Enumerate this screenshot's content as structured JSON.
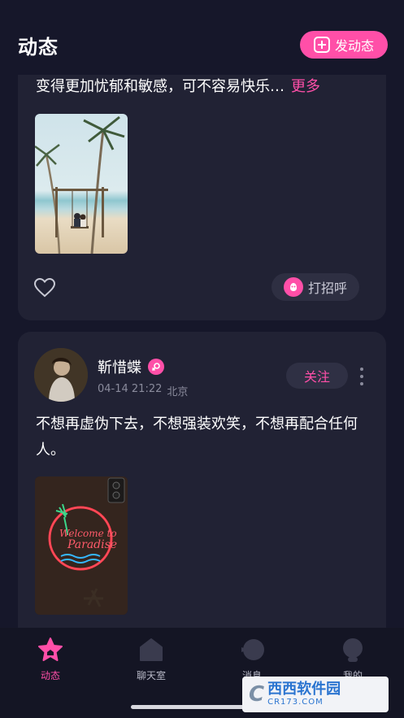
{
  "header": {
    "title": "动态",
    "post_button_label": "发动态"
  },
  "feed": {
    "posts": [
      {
        "text": "变得更加忧郁和敏感，可不容易快乐…",
        "more_label": "更多",
        "greet_label": "打招呼"
      },
      {
        "username": "靳惜蝶",
        "date": "04-14 21:22",
        "location": "北京",
        "follow_label": "关注",
        "text": "不想再虚伪下去，不想强装欢笑，不想再配合任何人。"
      }
    ]
  },
  "tabbar": {
    "tabs": [
      {
        "label": "动态",
        "icon": "star-home-icon",
        "active": true
      },
      {
        "label": "聊天室",
        "icon": "chat-room-icon",
        "active": false
      },
      {
        "label": "消息",
        "icon": "message-icon",
        "active": false
      },
      {
        "label": "我的",
        "icon": "profile-icon",
        "active": false
      }
    ]
  },
  "watermark": {
    "main_text": "西西软件园",
    "sub_text": "CR173.COM"
  },
  "colors": {
    "accent": "#ff4fa8",
    "background": "#16172a",
    "card": "#212234"
  }
}
